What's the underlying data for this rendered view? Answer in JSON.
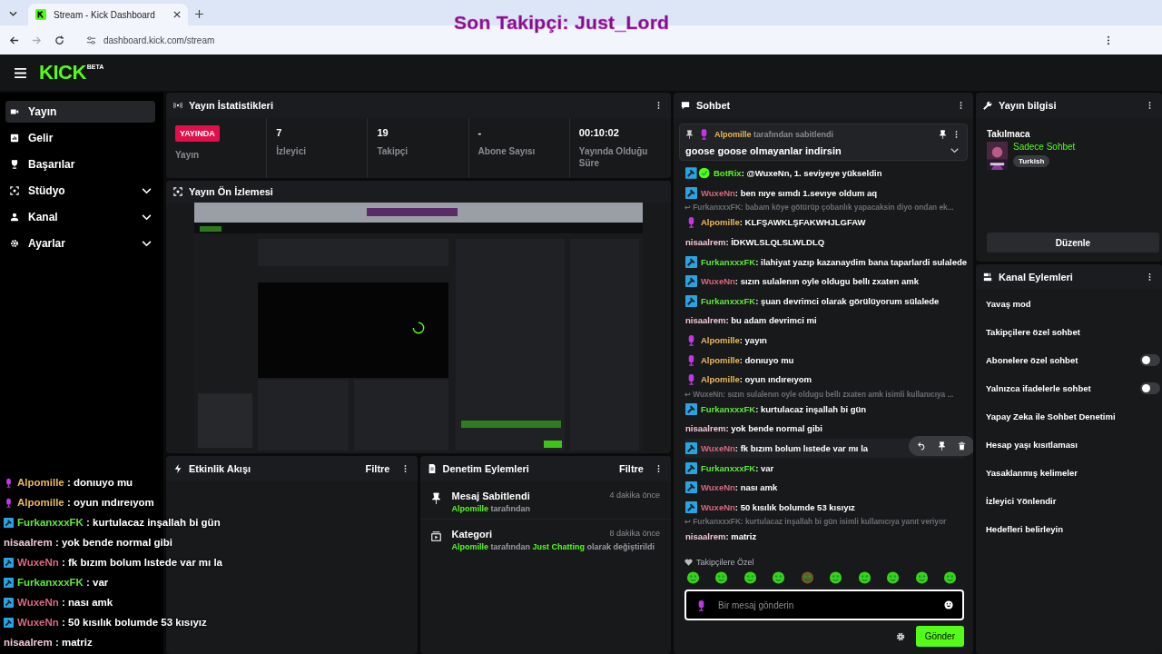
{
  "browser": {
    "tab_title": "Stream - Kick Dashboard",
    "url": "dashboard.kick.com/stream"
  },
  "stream_overlay": {
    "text": "Son Takipçi: Just_Lord"
  },
  "topbar": {
    "logo": "KICK",
    "logo_badge": "BETA"
  },
  "sidebar": {
    "items": [
      {
        "label": "Yayın",
        "kind": "link",
        "selected": true
      },
      {
        "label": "Gelir",
        "kind": "link",
        "selected": false
      },
      {
        "label": "Başarılar",
        "kind": "link",
        "selected": false
      },
      {
        "label": "Stüdyo",
        "kind": "group",
        "selected": false
      },
      {
        "label": "Kanal",
        "kind": "group",
        "selected": false
      },
      {
        "label": "Ayarlar",
        "kind": "group",
        "selected": false
      }
    ]
  },
  "stats": {
    "title": "Yayın İstatistikleri",
    "live_badge": "YAYINDA",
    "cells": [
      {
        "kind": "badge",
        "label": "Yayın"
      },
      {
        "kind": "value",
        "value": "7",
        "label": "İzleyici"
      },
      {
        "kind": "value",
        "value": "19",
        "label": "Takipçi"
      },
      {
        "kind": "value",
        "value": "-",
        "label": "Abone Sayısı"
      },
      {
        "kind": "value",
        "value": "00:10:02",
        "label": "Yayında Olduğu Süre"
      }
    ]
  },
  "preview": {
    "title": "Yayın Ön İzlemesi",
    "kind": "picture"
  },
  "activity": {
    "title": "Etkinlik Akışı",
    "filter": "Filtre"
  },
  "moderation": {
    "title": "Denetim Eylemleri",
    "filter": "Filtre",
    "items": [
      {
        "kind": "pin",
        "title": "Mesaj Sabitlendi",
        "time": "4 dakika önce",
        "text": "**Alpomille** tarafından"
      },
      {
        "kind": "category",
        "title": "Kategori",
        "time": "8 dakika önce",
        "text": "**Alpomille** tarafından **Just Chatting** olarak değiştirildi"
      }
    ]
  },
  "chat": {
    "title": "Sohbet",
    "pinned": {
      "user": "Alpomille",
      "by": "tarafından sabitlendi",
      "message": "goose goose olmayanlar indirsin"
    },
    "messages": [
      {
        "kind": "bot",
        "user": "BotRix",
        "color": "#53fc18",
        "text": ": @WuxeNn, 1. seviyeye yükseldin",
        "hovered": false
      },
      {
        "kind": "mod",
        "user": "WuxeNn",
        "color": "#d9677f",
        "text": ": ben nıye sımdı 1.sevıye oldum aq",
        "hovered": false
      },
      {
        "kind": "reply",
        "text": "↩ FurkanxxxFK: babam köye götürüp çobanlık yapacaksin diyo ondan ek..."
      },
      {
        "kind": "mic",
        "user": "Alpomille",
        "color": "#e8b75b",
        "text": ": KLFŞAWKLŞFAKWHJLGFAW",
        "hovered": false
      },
      {
        "kind": "plain",
        "user": "nisaalrem",
        "color": "#f2c6d8",
        "text": ": İDKWLSLQLSLWLDLQ",
        "hovered": false
      },
      {
        "kind": "mod",
        "user": "FurkanxxxFK",
        "color": "#5ee93a",
        "text": ": ilahiyat yazıp kazanaydim bana taparlardi sulalede",
        "hovered": false
      },
      {
        "kind": "mod",
        "user": "WuxeNn",
        "color": "#d9677f",
        "text": ": sızın sulalenın oyle oldugu bellı zxaten amk",
        "hovered": false
      },
      {
        "kind": "mod",
        "user": "FurkanxxxFK",
        "color": "#5ee93a",
        "text": ": şuan devrimci olarak görülüyorum sülalede",
        "hovered": false
      },
      {
        "kind": "plain",
        "user": "nisaalrem",
        "color": "#f2c6d8",
        "text": ": bu adam devrimci mi",
        "hovered": false
      },
      {
        "kind": "mic",
        "user": "Alpomille",
        "color": "#e8b75b",
        "text": ": yayın",
        "hovered": false
      },
      {
        "kind": "mic",
        "user": "Alpomille",
        "color": "#e8b75b",
        "text": ": donıuyo mu",
        "hovered": false
      },
      {
        "kind": "mic",
        "user": "Alpomille",
        "color": "#e8b75b",
        "text": ": oyun ındıreıyom",
        "hovered": false
      },
      {
        "kind": "reply",
        "text": "↩ WuxeNn: sızın sulalenın oyle oldugu bellı zxaten amk isimli kullanıcıya ..."
      },
      {
        "kind": "mod",
        "user": "FurkanxxxFK",
        "color": "#5ee93a",
        "text": ": kurtulacaz inşallah bi gün",
        "hovered": false
      },
      {
        "kind": "plain",
        "user": "nisaalrem",
        "color": "#f2c6d8",
        "text": ": yok bende normal gibi",
        "hovered": false
      },
      {
        "kind": "mod",
        "user": "WuxeNn",
        "color": "#d9677f",
        "text": ": fk bızım bolum lıstede var mı la",
        "hovered": true
      },
      {
        "kind": "mod",
        "user": "FurkanxxxFK",
        "color": "#5ee93a",
        "text": ": var",
        "hovered": false
      },
      {
        "kind": "mod",
        "user": "WuxeNn",
        "color": "#d9677f",
        "text": ": nası amk",
        "hovered": false
      },
      {
        "kind": "mod",
        "user": "WuxeNn",
        "color": "#d9677f",
        "text": ": 50 kısılık bolumde 53 kısıyız",
        "hovered": false
      },
      {
        "kind": "reply",
        "text": "↩ FurkanxxxFK: kurtulacaz inşallah bi gün isimli kullanıcıya yanıt veriyor"
      },
      {
        "kind": "plain",
        "user": "nisaalrem",
        "color": "#f2c6d8",
        "text": ": matriz",
        "hovered": false
      }
    ],
    "emote_section": "Takipçilere Özel",
    "input_placeholder": "Bir mesaj gönderin",
    "send": "Gönder"
  },
  "stream_info": {
    "title": "Yayın bilgisi",
    "stream_title": "Takılmaca",
    "category": "Sadece Sohbet",
    "tag": "Turkish",
    "edit": "Düzenle"
  },
  "channel_actions": {
    "title": "Kanal Eylemleri",
    "items": [
      {
        "kind": "plain",
        "label": "Yavaş mod"
      },
      {
        "kind": "plain",
        "label": "Takipçilere özel sohbet"
      },
      {
        "kind": "toggle",
        "label": "Abonelere özel sohbet",
        "on": false
      },
      {
        "kind": "toggle",
        "label": "Yalnızca ifadelerle sohbet",
        "on": false
      },
      {
        "kind": "plain",
        "label": "Yapay Zeka ile Sohbet Denetimi"
      },
      {
        "kind": "plain",
        "label": "Hesap yaşı kısıtlaması"
      },
      {
        "kind": "plain",
        "label": "Yasaklanmış kelimeler"
      },
      {
        "kind": "plain",
        "label": "İzleyici Yönlendir"
      },
      {
        "kind": "plain",
        "label": "Hedefleri belirleyin"
      }
    ]
  },
  "overlay_chat": [
    {
      "kind": "mic",
      "user": "Alpomille",
      "color": "#e8b75b",
      "text": ": donıuyo mu"
    },
    {
      "kind": "mic",
      "user": "Alpomille",
      "color": "#e8b75b",
      "text": ": oyun ındıreıyom"
    },
    {
      "kind": "mod",
      "user": "FurkanxxxFK",
      "color": "#5ee93a",
      "text": ": kurtulacaz inşallah bi gün"
    },
    {
      "kind": "plain",
      "user": "nisaalrem",
      "color": "#f2c6d8",
      "text": ": yok bende normal gibi"
    },
    {
      "kind": "mod",
      "user": "WuxeNn",
      "color": "#d9677f",
      "text": ": fk bızım bolum lıstede var mı la"
    },
    {
      "kind": "mod",
      "user": "FurkanxxxFK",
      "color": "#5ee93a",
      "text": ": var"
    },
    {
      "kind": "mod",
      "user": "WuxeNn",
      "color": "#d9677f",
      "text": ": nası amk"
    },
    {
      "kind": "mod",
      "user": "WuxeNn",
      "color": "#d9677f",
      "text": ": 50 kısılık bolumde 53 kısıyız"
    },
    {
      "kind": "plain",
      "user": "nisaalrem",
      "color": "#f2c6d8",
      "text": ": matriz"
    }
  ]
}
